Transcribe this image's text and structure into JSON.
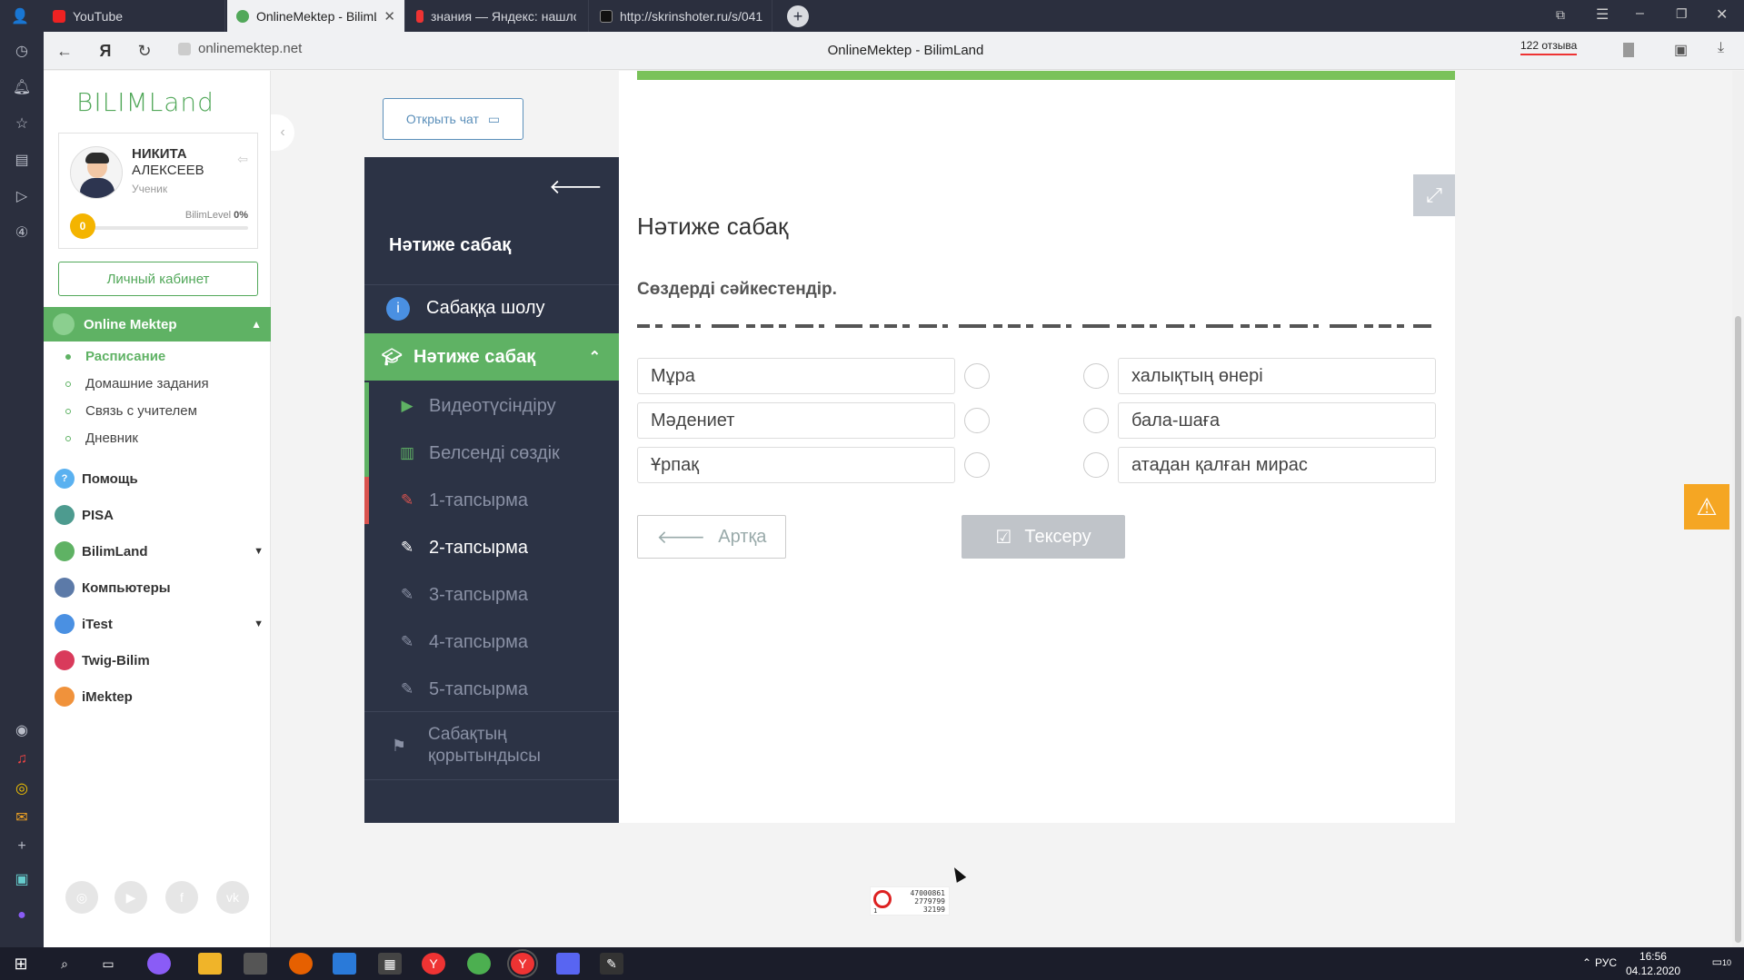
{
  "browser": {
    "tabs": [
      {
        "label": "YouTube",
        "color": "#e22"
      },
      {
        "label": "OnlineMektep - BilimLa",
        "color": "#52a85a"
      },
      {
        "label": "знания — Яндекс: нашлос",
        "color": "#e33"
      },
      {
        "label": "http://skrinshoter.ru/s/041",
        "color": "#222"
      }
    ],
    "url": "onlinemektep.net",
    "title": "OnlineMektep - BilimLand",
    "reviews": "122 отзыва"
  },
  "sidebar": {
    "logo": "BILIMLand",
    "profile": {
      "first_name": "НИКИТА",
      "last_name": "АЛЕКСЕЕВ",
      "role": "Ученик",
      "level": "0",
      "level_label": "BilimLevel",
      "level_percent": "0%"
    },
    "cabinet_button": "Личный кабинет",
    "section_header": "Online Mektep",
    "sub_items": [
      "Расписание",
      "Домашние задания",
      "Связь с учителем",
      "Дневник"
    ],
    "nav_items": [
      {
        "label": "Помощь",
        "color": "#5ab1f0"
      },
      {
        "label": "PISA",
        "color": "#4d9b8f"
      },
      {
        "label": "BilimLand",
        "color": "#5fb264"
      },
      {
        "label": "Компьютеры",
        "color": "#5c7aa8"
      },
      {
        "label": "iTest",
        "color": "#4a90e2"
      },
      {
        "label": "Twig-Bilim",
        "color": "#d93a5b"
      },
      {
        "label": "iMektep",
        "color": "#f0923b"
      }
    ]
  },
  "chat_button": "Открыть чат",
  "lesson_nav": {
    "title": "Нәтиже сабақ",
    "overview": "Сабаққа шолу",
    "section": "Нәтиже сабақ",
    "items": [
      "Видеотүсіндіру",
      "Белсенді сөздік",
      "1-тапсырма",
      "2-тапсырма",
      "3-тапсырма",
      "4-тапсырма",
      "5-тапсырма"
    ],
    "summary": "Сабақтың қорытындысы"
  },
  "content": {
    "title": "Нәтиже сабақ",
    "task": "Сөздерді сәйкестендір.",
    "left_words": [
      "Мұра",
      "Мәдениет",
      "Ұрпақ"
    ],
    "right_words": [
      "халықтың өнері",
      "бала-шаға",
      "атадан қалған мирас"
    ],
    "back_button": "Артқа",
    "check_button": "Тексеру"
  },
  "counter": {
    "line1": "47000861",
    "line2": "2779799",
    "line3": "32199",
    "corner": "1"
  },
  "taskbar": {
    "lang": "РУС",
    "time": "16:56",
    "date": "04.12.2020",
    "notifications": "10"
  }
}
